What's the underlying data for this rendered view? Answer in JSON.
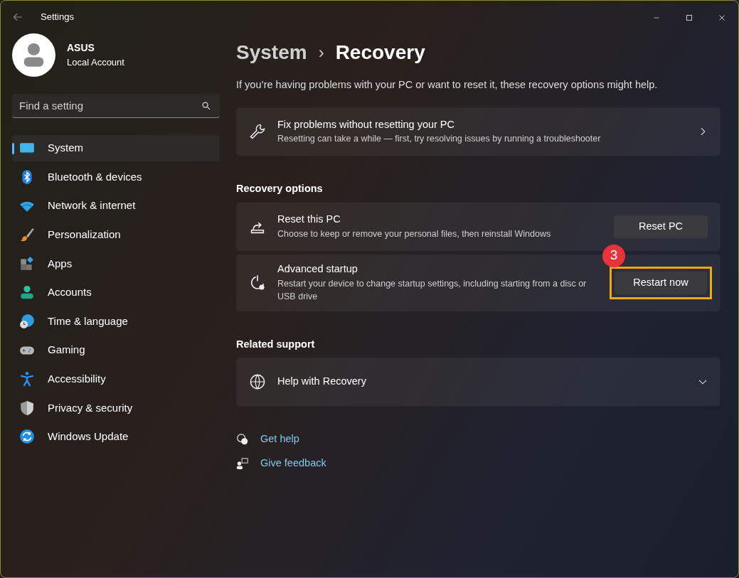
{
  "window": {
    "title": "Settings"
  },
  "account": {
    "name": "ASUS",
    "type": "Local Account"
  },
  "search": {
    "placeholder": "Find a setting"
  },
  "sidebar": {
    "items": [
      {
        "label": "System",
        "selected": true
      },
      {
        "label": "Bluetooth & devices",
        "selected": false
      },
      {
        "label": "Network & internet",
        "selected": false
      },
      {
        "label": "Personalization",
        "selected": false
      },
      {
        "label": "Apps",
        "selected": false
      },
      {
        "label": "Accounts",
        "selected": false
      },
      {
        "label": "Time & language",
        "selected": false
      },
      {
        "label": "Gaming",
        "selected": false
      },
      {
        "label": "Accessibility",
        "selected": false
      },
      {
        "label": "Privacy & security",
        "selected": false
      },
      {
        "label": "Windows Update",
        "selected": false
      }
    ]
  },
  "breadcrumb": {
    "parent": "System",
    "separator": "›",
    "current": "Recovery"
  },
  "intro": "If you’re having problems with your PC or want to reset it, these recovery options might help.",
  "fix_card": {
    "title": "Fix problems without resetting your PC",
    "description": "Resetting can take a while — first, try resolving issues by running a troubleshooter"
  },
  "recovery_options": {
    "heading": "Recovery options",
    "rows": [
      {
        "title": "Reset this PC",
        "description": "Choose to keep or remove your personal files, then reinstall Windows",
        "button": "Reset PC",
        "highlighted": false
      },
      {
        "title": "Advanced startup",
        "description": "Restart your device to change startup settings, including starting from a disc or USB drive",
        "button": "Restart now",
        "highlighted": true,
        "step_badge": "3"
      }
    ]
  },
  "related_support": {
    "heading": "Related support",
    "item": {
      "title": "Help with Recovery",
      "expanded": false
    }
  },
  "links": [
    "Get help",
    "Give feedback"
  ]
}
